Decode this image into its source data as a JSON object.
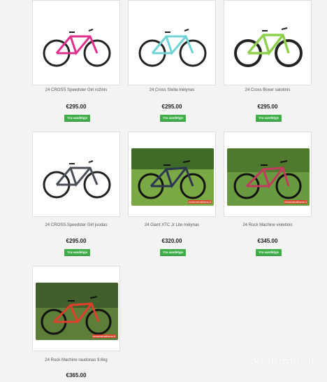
{
  "products": [
    {
      "name": "24 CROSS Speedster Girl rožinis",
      "price": "€295.00",
      "availability": "Yra sandėlyje",
      "frame_color": "#e0308d"
    },
    {
      "name": "24 Cross Stella mėlynas",
      "price": "€295.00",
      "availability": "Yra sandėlyje",
      "frame_color": "#6fd3d6"
    },
    {
      "name": "24 Cross Boxer salotinis",
      "price": "€295.00",
      "availability": "Yra sandėlyje",
      "frame_color": "#8fd14f"
    },
    {
      "name": "24 CROSS Speedster Girl juodas",
      "price": "€295.00",
      "availability": "Yra sandėlyje",
      "frame_color": "#4a4e57"
    },
    {
      "name": "24 Giant XTC Jr Lite mėlynas",
      "price": "€320.00",
      "availability": "Yra sandėlyje",
      "frame_color": "#2c3550"
    },
    {
      "name": "24 Rock Machine violetinis",
      "price": "€345.00",
      "availability": "Yra sandėlyje",
      "frame_color": "#c23a5e"
    },
    {
      "name": "24 Rock Machine raudonas 9.6kg",
      "price": "€365.00",
      "frame_color": "#e0402b"
    }
  ],
  "watermark": "dviraciaivaikams.lt",
  "site_logo": "skelbimai.lt",
  "icons": {
    "product_image": "bicycle-icon"
  }
}
